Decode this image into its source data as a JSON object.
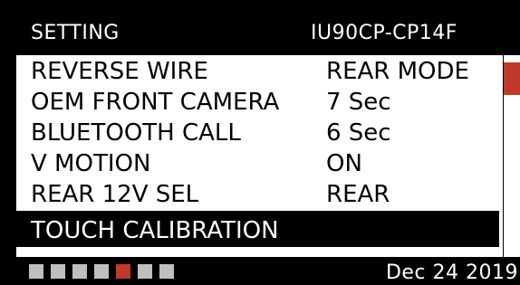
{
  "header": {
    "title": "SETTING",
    "model": "IU90CP-CP14F"
  },
  "menu": {
    "items": [
      {
        "label": "REVERSE WIRE",
        "value": "REAR MODE"
      },
      {
        "label": "OEM FRONT CAMERA",
        "value": "7 Sec"
      },
      {
        "label": "BLUETOOTH CALL",
        "value": "6 Sec"
      },
      {
        "label": "V MOTION",
        "value": "ON"
      },
      {
        "label": "REAR 12V SEL",
        "value": "REAR"
      },
      {
        "label": "TOUCH CALIBRATION",
        "value": ""
      }
    ],
    "selected_index": 5
  },
  "footer": {
    "page_count": 7,
    "active_page": 5,
    "date": "Dec 24 2019"
  },
  "colors": {
    "accent": "#c0392b",
    "background": "#000000",
    "panel": "#ffffff",
    "inactive_dot": "#bfbfbf"
  }
}
